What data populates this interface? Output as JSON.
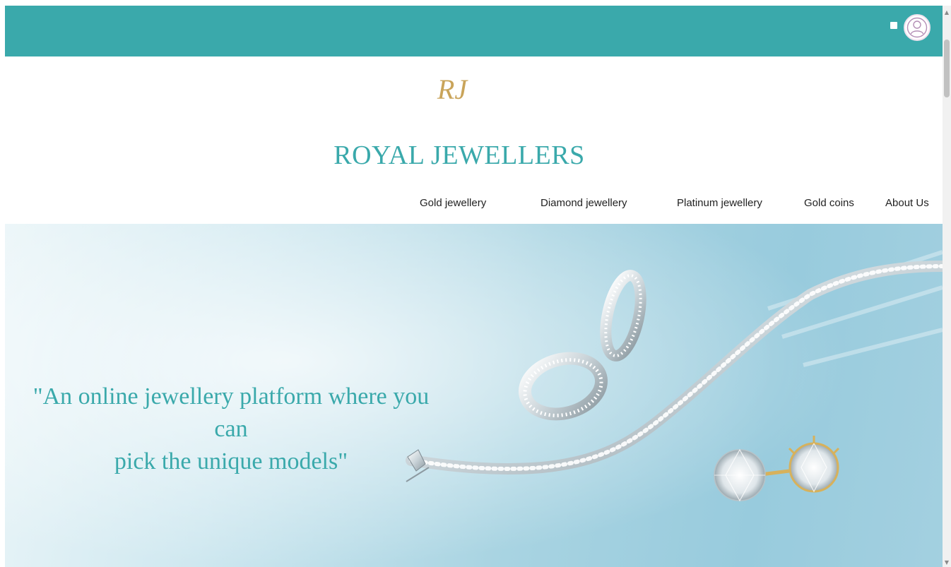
{
  "header": {
    "menu_icon": "square-dot-icon",
    "avatar_icon": "user-avatar-icon"
  },
  "brand": {
    "monogram": "RJ",
    "title": "ROYAL JEWELLERS"
  },
  "nav": {
    "items": [
      {
        "label": "Gold jewellery"
      },
      {
        "label": "Diamond jewellery"
      },
      {
        "label": "Platinum jewellery"
      },
      {
        "label": "Gold coins"
      },
      {
        "label": "About Us"
      }
    ]
  },
  "hero": {
    "quote_line1": "\"An online jewellery platform where you can",
    "quote_line2": "pick the unique models\""
  },
  "colors": {
    "teal": "#3aa9ab",
    "gold": "#c9a45a"
  }
}
